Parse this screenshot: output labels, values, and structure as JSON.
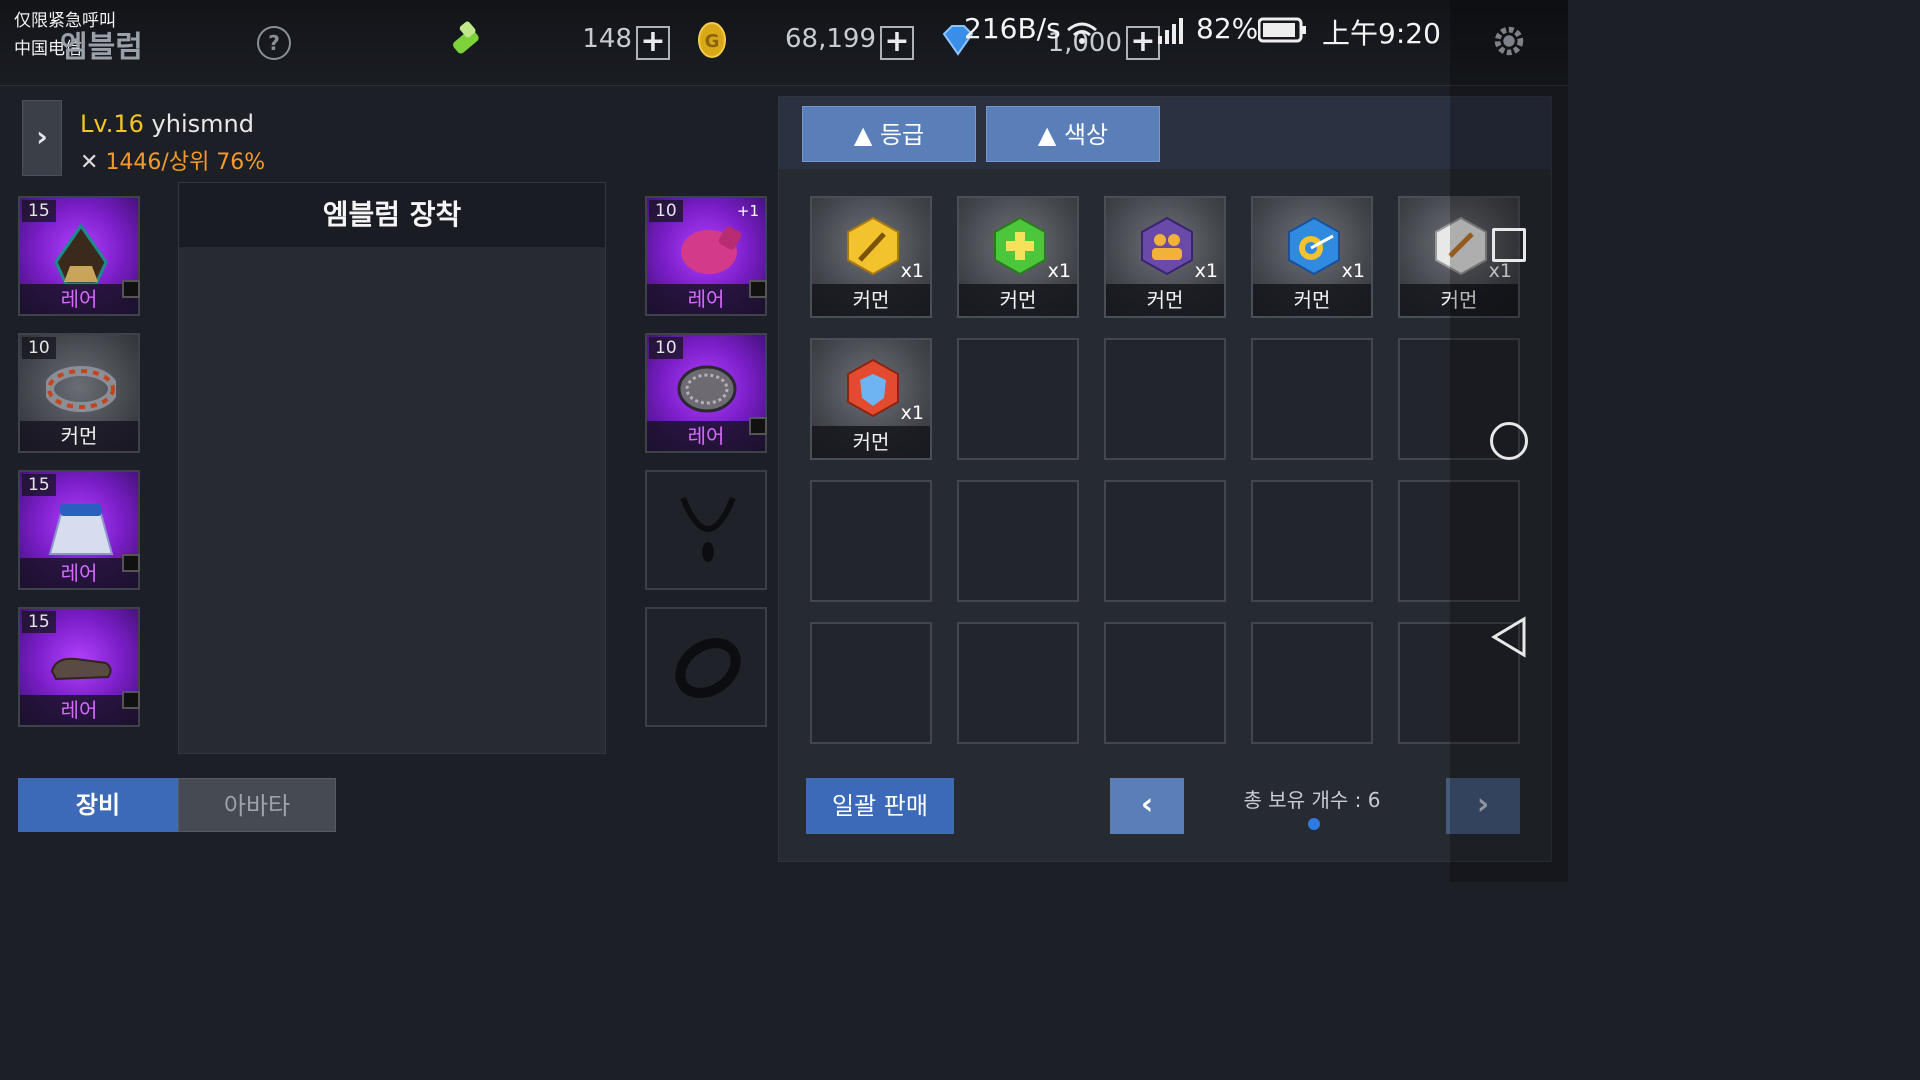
{
  "status_bar": {
    "line1": "仅限紧急呼叫",
    "line2": "中国电信",
    "speed": "216B/s",
    "battery": "82%",
    "time": "上午9:20"
  },
  "header": {
    "title": "엠블럼",
    "currencies": [
      {
        "icon": "energy-battery-icon",
        "value": "148"
      },
      {
        "icon": "gold-coin-icon",
        "value": "68,199"
      },
      {
        "icon": "gem-icon",
        "value": "1,000"
      }
    ]
  },
  "player": {
    "level_prefix": "Lv.16",
    "name": "yhismnd",
    "power": "1446/상위 76%"
  },
  "left_slots": [
    {
      "level": "15",
      "grade": "레어",
      "icon": "hood-icon"
    },
    {
      "level": "10",
      "grade": "커먼",
      "icon": "bracelet-icon"
    },
    {
      "level": "15",
      "grade": "레어",
      "icon": "skirt-icon"
    },
    {
      "level": "15",
      "grade": "레어",
      "icon": "shoes-icon"
    }
  ],
  "right_slots": [
    {
      "level": "10",
      "enhance": "+1",
      "grade": "레어",
      "icon": "boxing-glove-icon"
    },
    {
      "level": "10",
      "grade": "레어",
      "icon": "gauntlet-icon"
    },
    {
      "icon": "necklace-icon"
    },
    {
      "icon": "ring-icon"
    }
  ],
  "emblem_panel": {
    "title": "엠블럼 장착"
  },
  "tabs": {
    "equip": "장비",
    "avatar": "아바타"
  },
  "inventory": {
    "sort_grade": "등급",
    "sort_color": "색상",
    "items": [
      {
        "grade": "커먼",
        "qty": "x1",
        "icon": "sword-emblem-icon",
        "color": "#f2c32c"
      },
      {
        "grade": "커먼",
        "qty": "x1",
        "icon": "heal-emblem-icon",
        "color": "#4cc63a"
      },
      {
        "grade": "커먼",
        "qty": "x1",
        "icon": "party-emblem-icon",
        "color": "#6a4aa8"
      },
      {
        "grade": "커먼",
        "qty": "x1",
        "icon": "target-emblem-icon",
        "color": "#2f8ae0"
      },
      {
        "grade": "커먼",
        "qty": "x1",
        "icon": "fist-emblem-icon",
        "color": "#e8e8e8"
      },
      {
        "grade": "커먼",
        "qty": "x1",
        "icon": "shield-emblem-icon",
        "color": "#e24b30"
      }
    ],
    "sell_all": "일괄 판매",
    "total": "총 보유 개수 : 6"
  }
}
